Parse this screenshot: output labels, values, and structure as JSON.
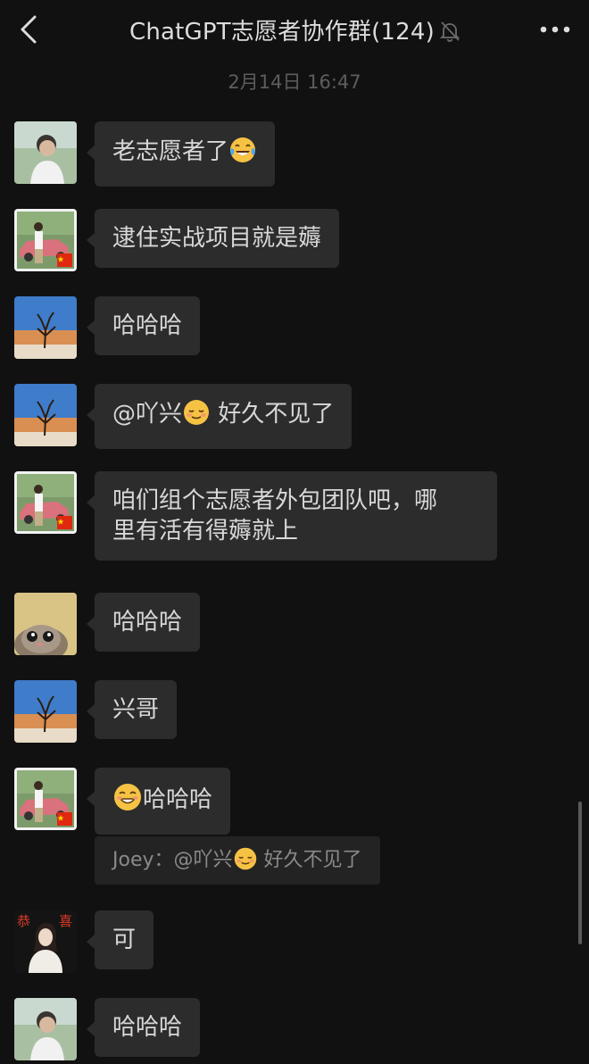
{
  "header": {
    "title": "ChatGPT志愿者协作群(124)",
    "back_icon": "chevron-left-icon",
    "mute_icon": "bell-off-icon",
    "more_icon": "more-horizontal-icon"
  },
  "timestamp": "2月14日 16:47",
  "messages": [
    {
      "text": "老志愿者了",
      "emoji": "tears-of-joy-emoji",
      "avatar": "avatar-young-man"
    },
    {
      "text": "逮住实战项目就是薅",
      "avatar": "avatar-man-car-flag"
    },
    {
      "text": "哈哈哈",
      "avatar": "avatar-desert-tree"
    },
    {
      "text_before": "@吖兴",
      "emoji": "relieved-emoji",
      "text_after": " 好久不见了",
      "avatar": "avatar-desert-tree"
    },
    {
      "text": "咱们组个志愿者外包团队吧，哪\n里有活有得薅就上",
      "avatar": "avatar-man-car-flag"
    },
    {
      "text": "哈哈哈",
      "avatar": "avatar-cat"
    },
    {
      "text": "兴哥",
      "avatar": "avatar-desert-tree"
    },
    {
      "text": "哈哈哈",
      "emoji": "grin-emoji",
      "avatar": "avatar-man-car-flag"
    },
    {
      "text": "可",
      "avatar": "avatar-woman-gongxi"
    },
    {
      "text": "哈哈哈",
      "avatar": "avatar-young-man"
    }
  ],
  "quote": {
    "author": "Joey",
    "separator": "：",
    "text_before": "@吖兴",
    "emoji": "relieved-emoji",
    "text_after": " 好久不见了"
  },
  "avatar_text": {
    "gongxi_left": "恭",
    "gongxi_right": "喜"
  },
  "colors": {
    "background": "#111111",
    "bubble": "#2c2c2c",
    "text": "#d8d8d8",
    "meta": "#5d5d5d"
  }
}
